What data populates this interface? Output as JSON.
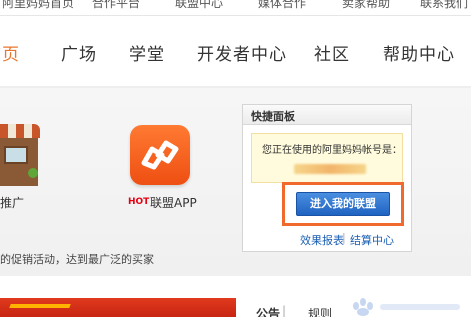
{
  "topbar": {
    "items": [
      "阿里妈妈首页",
      "合作平台",
      "联盟中心",
      "媒体合作",
      "卖家帮助",
      "联系我们"
    ]
  },
  "nav": {
    "items": [
      "首页",
      "广场",
      "学堂",
      "开发者中心",
      "社区",
      "帮助中心"
    ],
    "active_index": 0,
    "accent_color": "#e8772e"
  },
  "content": {
    "shop_label": "推广",
    "app_badge": "HOT",
    "app_label": "联盟APP",
    "promo_text": "的促销活动，达到最广泛的买家"
  },
  "quick_panel": {
    "title": "快捷面板",
    "notice_text": "您正在使用的阿里妈妈帐号是：",
    "enter_button": "进入我的联盟",
    "links": [
      "效果报表",
      "结算中心"
    ],
    "separator": "|"
  },
  "bottom": {
    "tabs": [
      "公告",
      "规则"
    ]
  },
  "colors": {
    "highlight_frame": "#ef6a2c",
    "button_blue": "#1f63c2",
    "link_blue": "#1a5fb4"
  }
}
